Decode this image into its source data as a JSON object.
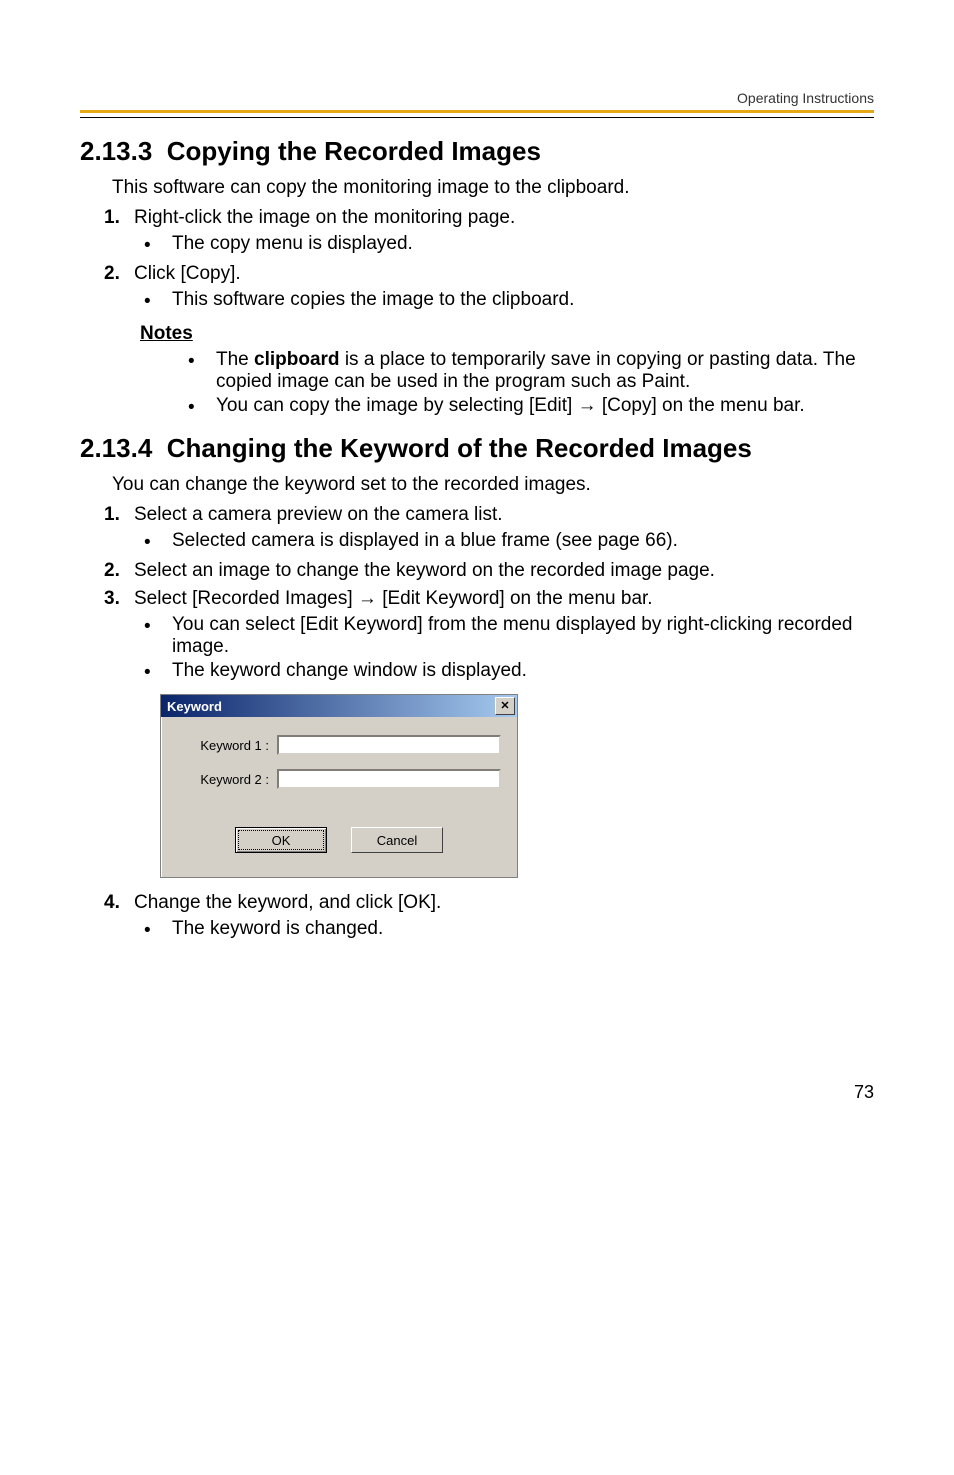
{
  "header": {
    "doc_title": "Operating Instructions"
  },
  "section_a": {
    "number": "2.13.3",
    "title": "Copying the Recorded Images",
    "intro": "This software can copy the monitoring image to the clipboard.",
    "steps": [
      {
        "num": "1.",
        "text": "Right-click the image on the monitoring page.",
        "bullets": [
          "The copy menu is displayed."
        ]
      },
      {
        "num": "2.",
        "text": "Click [Copy].",
        "bullets": [
          "This software copies the image to the clipboard."
        ]
      }
    ],
    "notes_heading": "Notes",
    "notes": [
      "The clipboard is a place to temporarily save in copying or pasting data. The copied image can be used in the program such as Paint.",
      "You can copy the image by selecting [Edit] → [Copy] on the menu bar."
    ],
    "bold_word": "clipboard"
  },
  "section_b": {
    "number": "2.13.4",
    "title": "Changing the Keyword of the Recorded Images",
    "intro": "You can change the keyword set to the recorded images.",
    "steps": [
      {
        "num": "1.",
        "text": "Select a camera preview on the camera list.",
        "bullets": [
          "Selected camera is displayed in a blue frame (see page 66)."
        ]
      },
      {
        "num": "2.",
        "text": "Select an image to change the keyword on the recorded image page.",
        "bullets": []
      },
      {
        "num": "3.",
        "text": "Select [Recorded Images] → [Edit Keyword] on the menu bar.",
        "bullets": [
          "You can select [Edit Keyword] from the menu displayed by right-clicking recorded image.",
          "The keyword change window is displayed."
        ]
      }
    ],
    "step4": {
      "num": "4.",
      "text": "Change the keyword, and click [OK].",
      "bullets": [
        "The keyword is changed."
      ]
    }
  },
  "dialog": {
    "title": "Keyword",
    "close_glyph": "✕",
    "label1": "Keyword 1 :",
    "label2": "Keyword 2 :",
    "value1": "",
    "value2": "",
    "ok": "OK",
    "cancel": "Cancel"
  },
  "page_number": "73"
}
